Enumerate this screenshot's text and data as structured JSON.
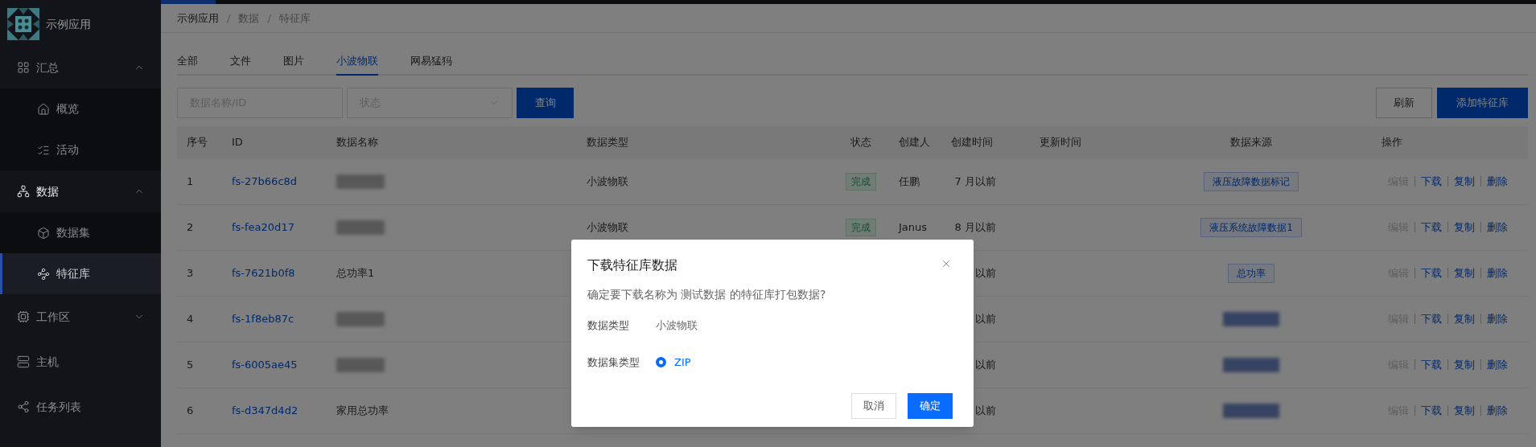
{
  "loading_bar": {
    "level": 0.04
  },
  "sidebar": {
    "app_name": "示例应用",
    "items": [
      {
        "label": "汇总",
        "expanded": true,
        "children": [
          {
            "label": "概览",
            "selected": false
          },
          {
            "label": "活动",
            "selected": false
          }
        ]
      },
      {
        "label": "数据",
        "expanded": true,
        "children": [
          {
            "label": "数据集",
            "selected": false
          },
          {
            "label": "特征库",
            "selected": true
          }
        ]
      },
      {
        "label": "工作区",
        "expanded": false
      },
      {
        "label": "主机",
        "selected": false
      },
      {
        "label": "任务列表",
        "selected": false
      }
    ]
  },
  "breadcrumb": [
    "示例应用",
    "数据",
    "特征库"
  ],
  "breadcrumb_separator": "/",
  "tabs": [
    {
      "label": "全部",
      "selected": false
    },
    {
      "label": "文件",
      "selected": false
    },
    {
      "label": "图片",
      "selected": false
    },
    {
      "label": "小波物联",
      "selected": true
    },
    {
      "label": "网易猛犸",
      "selected": false
    }
  ],
  "filters": {
    "search": {
      "placeholder": "数据名称/ID"
    },
    "status": {
      "placeholder": "状态"
    },
    "query_button": "查询",
    "refresh_button": "刷新",
    "add_button": "添加特征库"
  },
  "table": {
    "columns": [
      "序号",
      "ID",
      "数据名称",
      "数据类型",
      "状态",
      "创建人",
      "创建时间",
      "更新时间",
      "数据来源",
      "操作"
    ],
    "rows": [
      {
        "no": "1",
        "id": "fs-27b66c8d",
        "name_redacted": true,
        "type": "小波物联",
        "status": "完成",
        "creator": "任鹏",
        "created": "7 月以前",
        "source": "液压故障数据标记",
        "actions": [
          {
            "label": "编辑",
            "disabled": true
          },
          {
            "label": "下载",
            "disabled": false
          },
          {
            "label": "复制",
            "disabled": false
          },
          {
            "label": "删除",
            "disabled": false
          }
        ]
      },
      {
        "no": "2",
        "id": "fs-fea20d17",
        "name_redacted": true,
        "type": "小波物联",
        "status": "完成",
        "creator": "Janus",
        "created": "8 月以前",
        "source": "液压系统故障数据1",
        "actions": [
          {
            "label": "编辑",
            "disabled": true
          },
          {
            "label": "下载",
            "disabled": false
          },
          {
            "label": "复制",
            "disabled": false
          },
          {
            "label": "删除",
            "disabled": false
          }
        ]
      },
      {
        "no": "3",
        "id": "fs-7621b0f8",
        "name": "总功率1",
        "created": "以前",
        "source": "总功率",
        "actions": [
          {
            "label": "编辑",
            "disabled": true
          },
          {
            "label": "下载",
            "disabled": false
          },
          {
            "label": "复制",
            "disabled": false
          },
          {
            "label": "删除",
            "disabled": false
          }
        ]
      },
      {
        "no": "4",
        "id": "fs-1f8eb87c",
        "name_redacted": true,
        "created": "以前",
        "source_redacted": true,
        "actions": [
          {
            "label": "编辑",
            "disabled": true
          },
          {
            "label": "下载",
            "disabled": false
          },
          {
            "label": "复制",
            "disabled": false
          },
          {
            "label": "删除",
            "disabled": false
          }
        ]
      },
      {
        "no": "5",
        "id": "fs-6005ae45",
        "name_redacted": true,
        "created": "以前",
        "source_redacted": true,
        "actions": [
          {
            "label": "编辑",
            "disabled": true
          },
          {
            "label": "下载",
            "disabled": false
          },
          {
            "label": "复制",
            "disabled": false
          },
          {
            "label": "删除",
            "disabled": false
          }
        ]
      },
      {
        "no": "6",
        "id": "fs-d347d4d2",
        "name": "家用总功率",
        "created": "以前",
        "source_redacted": true,
        "actions": [
          {
            "label": "编辑",
            "disabled": true
          },
          {
            "label": "下载",
            "disabled": false
          },
          {
            "label": "复制",
            "disabled": false
          },
          {
            "label": "删除",
            "disabled": false
          }
        ]
      }
    ]
  },
  "dialog": {
    "title": "下载特征库数据",
    "message": "确定要下载名称为 测试数据 的特征库打包数据?",
    "fields": [
      {
        "label": "数据类型",
        "value": "小波物联"
      }
    ],
    "radio_group": {
      "label": "数据集类型",
      "options": [
        {
          "label": "ZIP",
          "selected": true
        }
      ]
    },
    "cancel_button": "取消",
    "confirm_button": "确定"
  }
}
